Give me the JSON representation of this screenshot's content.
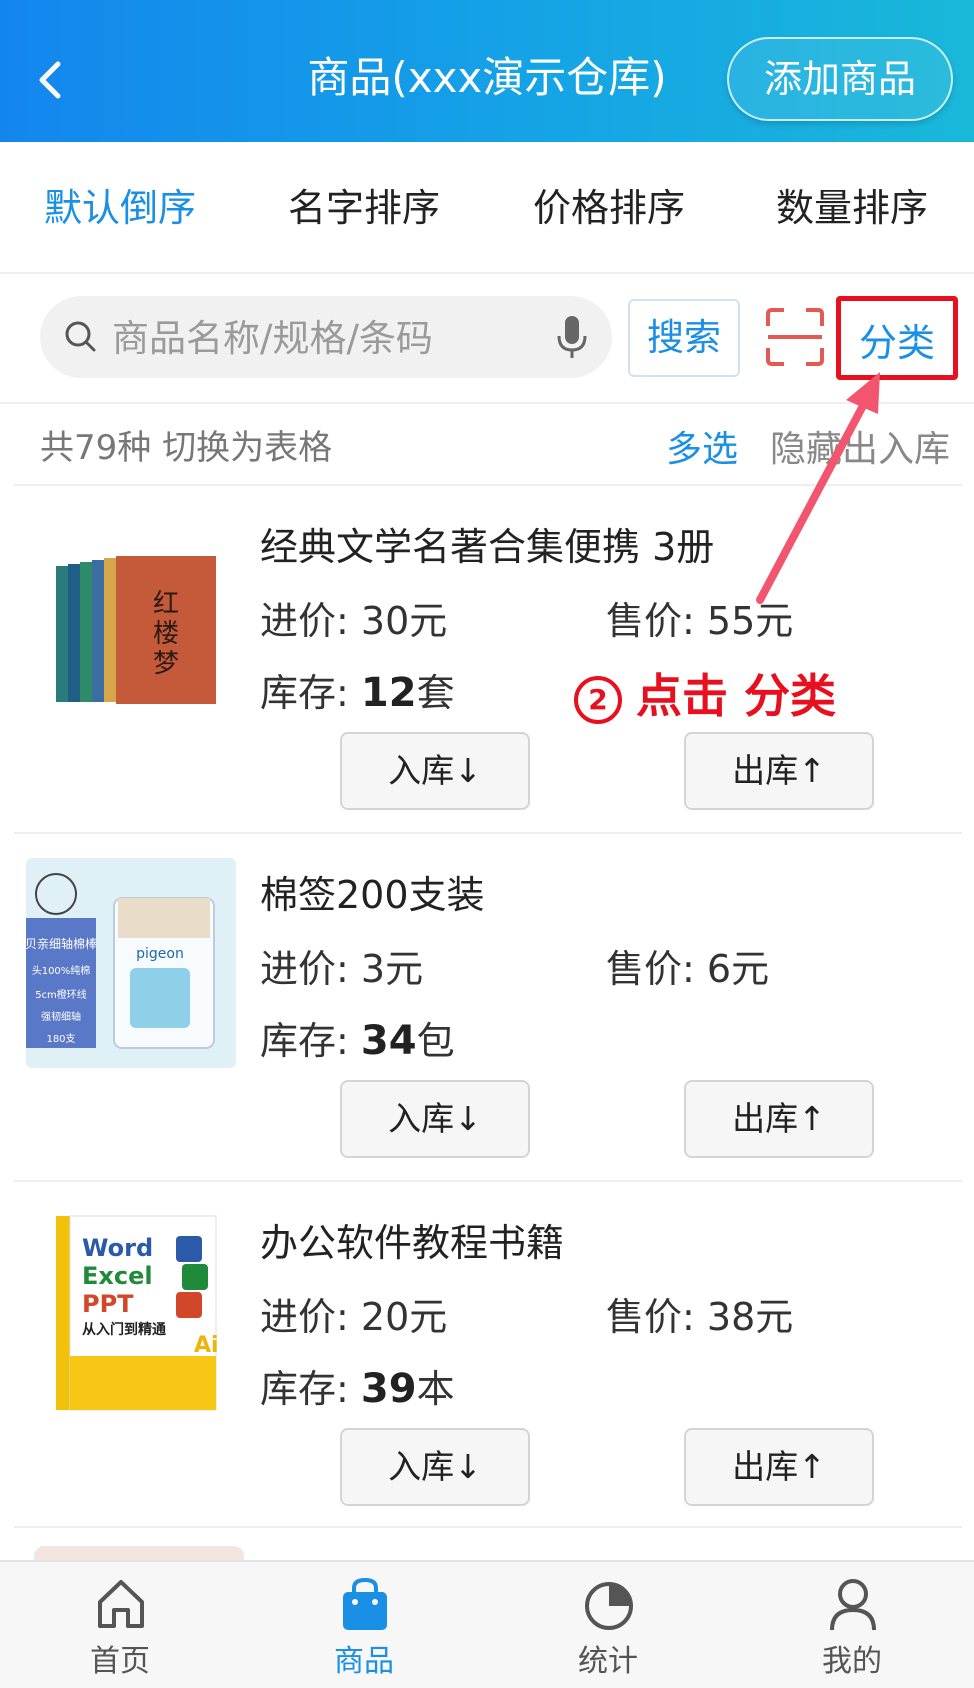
{
  "header": {
    "title": "商品(xxx演示仓库)",
    "add_button": "添加商品"
  },
  "sort_tabs": [
    {
      "label": "默认倒序",
      "active": true
    },
    {
      "label": "名字排序",
      "active": false
    },
    {
      "label": "价格排序",
      "active": false
    },
    {
      "label": "数量排序",
      "active": false
    }
  ],
  "search": {
    "placeholder": "商品名称/规格/条码",
    "button": "搜索",
    "category_button": "分类"
  },
  "info": {
    "count_text": "共79种  切换为表格",
    "multi_select": "多选",
    "hide_out": "隐藏出入库"
  },
  "products": [
    {
      "name": "经典文学名著合集便携   3册",
      "in_price_label": "进价: ",
      "in_price": "30元",
      "sale_label": "售价: ",
      "sale_price": "55元",
      "stock_label": "库存: ",
      "stock_qty": "12",
      "stock_unit": "套",
      "btn_in": "入库↓",
      "btn_out": "出库↑",
      "image": "book-set-image"
    },
    {
      "name": "棉签200支装",
      "in_price_label": "进价: ",
      "in_price": "3元",
      "sale_label": "售价: ",
      "sale_price": "6元",
      "stock_label": "库存: ",
      "stock_qty": "34",
      "stock_unit": "包",
      "btn_in": "入库↓",
      "btn_out": "出库↑",
      "image": "cotton-swab-image"
    },
    {
      "name": "办公软件教程书籍",
      "in_price_label": "进价: ",
      "in_price": "20元",
      "sale_label": "售价: ",
      "sale_price": "38元",
      "stock_label": "库存: ",
      "stock_qty": "39",
      "stock_unit": "本",
      "btn_in": "入库↓",
      "btn_out": "出库↑",
      "image": "office-book-image"
    }
  ],
  "annotation": {
    "number": "2",
    "text": "点击 分类",
    "color": "#e8101f"
  },
  "nav": [
    {
      "label": "首页",
      "icon": "home-icon",
      "active": false
    },
    {
      "label": "商品",
      "icon": "shopping-bag-icon",
      "active": true
    },
    {
      "label": "统计",
      "icon": "pie-chart-icon",
      "active": false
    },
    {
      "label": "我的",
      "icon": "user-icon",
      "active": false
    }
  ],
  "colors": {
    "accent": "#1a8fe6",
    "header_start": "#1386ee",
    "header_end": "#19b8d9",
    "highlight": "#e8101f"
  }
}
